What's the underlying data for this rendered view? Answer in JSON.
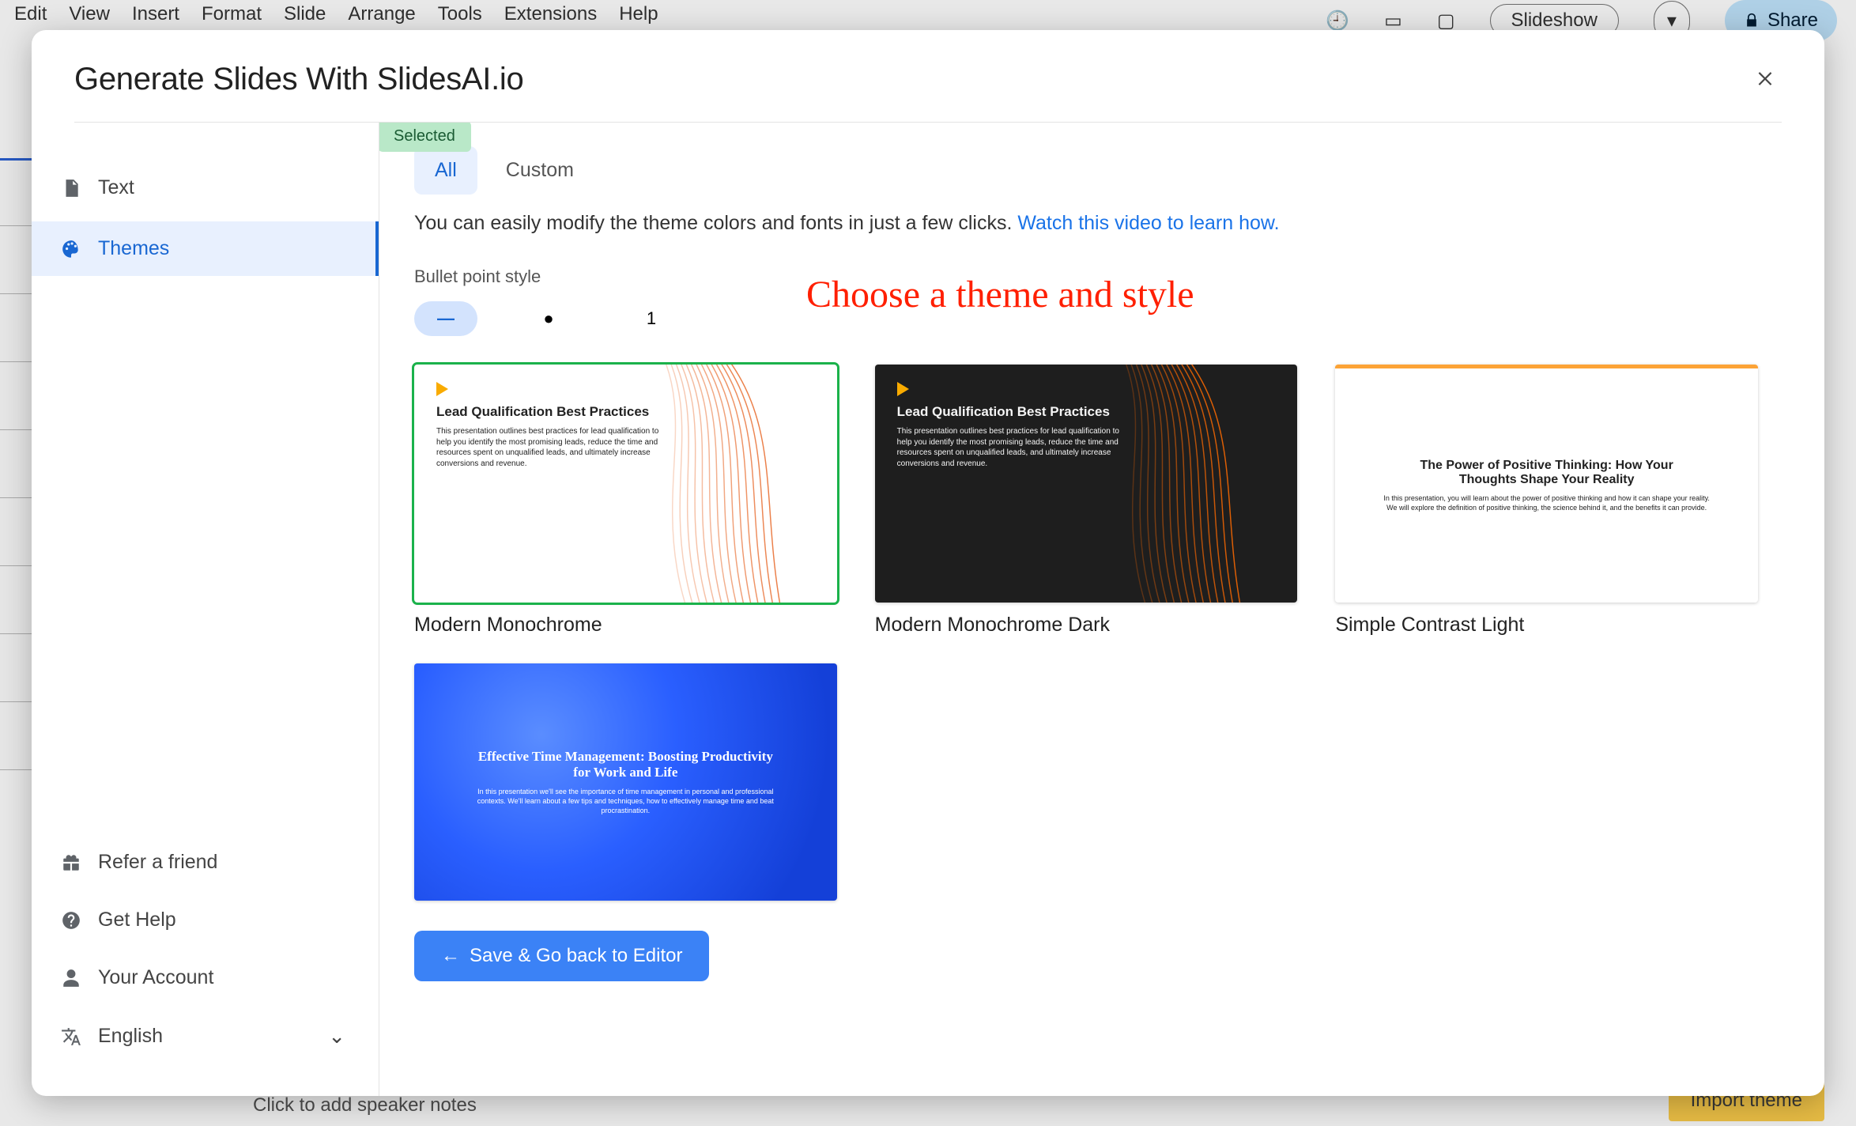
{
  "background": {
    "menu": [
      "Edit",
      "View",
      "Insert",
      "Format",
      "Slide",
      "Arrange",
      "Tools",
      "Extensions",
      "Help"
    ],
    "right": {
      "slideshow": "Slideshow",
      "share": "Share"
    },
    "footer": "Click to add speaker notes",
    "import_btn": "Import theme"
  },
  "modal": {
    "title": "Generate Slides With SlidesAI.io"
  },
  "sidebar": {
    "top": [
      {
        "label": "Text",
        "icon": "doc"
      },
      {
        "label": "Themes",
        "icon": "palette"
      }
    ],
    "bottom": [
      {
        "label": "Refer a friend",
        "icon": "gift"
      },
      {
        "label": "Get Help",
        "icon": "help"
      },
      {
        "label": "Your Account",
        "icon": "user"
      }
    ],
    "language": "English"
  },
  "tabs": {
    "all": "All",
    "custom": "Custom"
  },
  "helper": {
    "text": "You can easily modify the theme colors and fonts in just a few clicks. ",
    "link": "Watch this video to learn how."
  },
  "bullet_section_label": "Bullet point style",
  "bullet_options": [
    "—",
    "●",
    "1"
  ],
  "annotation": "Choose a theme and style",
  "selected_badge": "Selected",
  "themes": [
    {
      "name": "Modern Monochrome",
      "variant": "light",
      "selected": true,
      "title": "Lead Qualification Best Practices",
      "sub": "This presentation outlines best practices for lead qualification to help you identify the most promising leads, reduce the time and resources spent on unqualified leads, and ultimately increase conversions and revenue."
    },
    {
      "name": "Modern Monochrome Dark",
      "variant": "dark",
      "selected": false,
      "title": "Lead Qualification Best Practices",
      "sub": "This presentation outlines best practices for lead qualification to help you identify the most promising leads, reduce the time and resources spent on unqualified leads, and ultimately increase conversions and revenue."
    },
    {
      "name": "Simple Contrast Light",
      "variant": "simple",
      "selected": false,
      "title": "The Power of Positive Thinking: How Your Thoughts Shape Your Reality",
      "sub": "In this presentation, you will learn about the power of positive thinking and how it can shape your reality. We will explore the definition of positive thinking, the science behind it, and the benefits it can provide."
    },
    {
      "name": "",
      "variant": "blue",
      "selected": false,
      "title": "Effective Time Management: Boosting Productivity for Work and Life",
      "sub": "In this presentation we'll see the importance of time management in personal and professional contexts. We'll learn about a few tips and techniques, how to effectively manage time and beat procrastination."
    }
  ],
  "save_btn": "Save & Go back to Editor"
}
